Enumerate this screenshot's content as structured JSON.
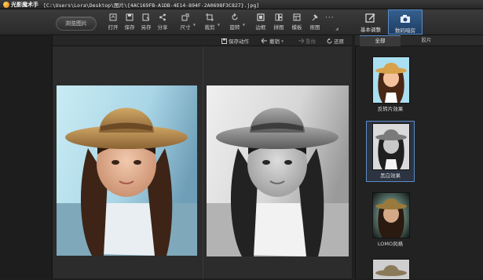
{
  "window": {
    "app_name": "光影魔术手",
    "file_path": "[C:\\Users\\Lora\\Desktop\\图片\\{4AC169FB-A1DB-4E14-894F-2A0698F3C827}.jpg]"
  },
  "toolbar": {
    "browse_label": "浏览图片",
    "tools": [
      {
        "label": "打开",
        "icon": "open-icon"
      },
      {
        "label": "保存",
        "icon": "save-icon"
      },
      {
        "label": "另存",
        "icon": "save-as-icon"
      },
      {
        "label": "分享",
        "icon": "share-icon"
      },
      {
        "label": "尺寸",
        "icon": "resize-icon"
      },
      {
        "label": "裁剪",
        "icon": "crop-icon"
      },
      {
        "label": "旋转",
        "icon": "rotate-icon"
      },
      {
        "label": "边框",
        "icon": "border-icon"
      },
      {
        "label": "拼图",
        "icon": "collage-icon"
      },
      {
        "label": "模板",
        "icon": "template-icon"
      },
      {
        "label": "抠图",
        "icon": "cutout-icon"
      }
    ],
    "more": "···"
  },
  "modes": {
    "basic_label": "基本调整",
    "digital_label": "数码暗房"
  },
  "subbar": {
    "save_action": "保存动作",
    "undo": "撤销",
    "redo": "重做",
    "restore": "还原"
  },
  "side_panel": {
    "tab_all": "全部",
    "tab_other": "胶片",
    "effects": [
      {
        "label": "反转片效果"
      },
      {
        "label": "黑白效果",
        "selected": true
      },
      {
        "label": "LOMO风格"
      }
    ]
  },
  "colors": {
    "accent": "#5b8cc4",
    "hat": "#b0874a",
    "sky_left": "#bfe3ef"
  }
}
